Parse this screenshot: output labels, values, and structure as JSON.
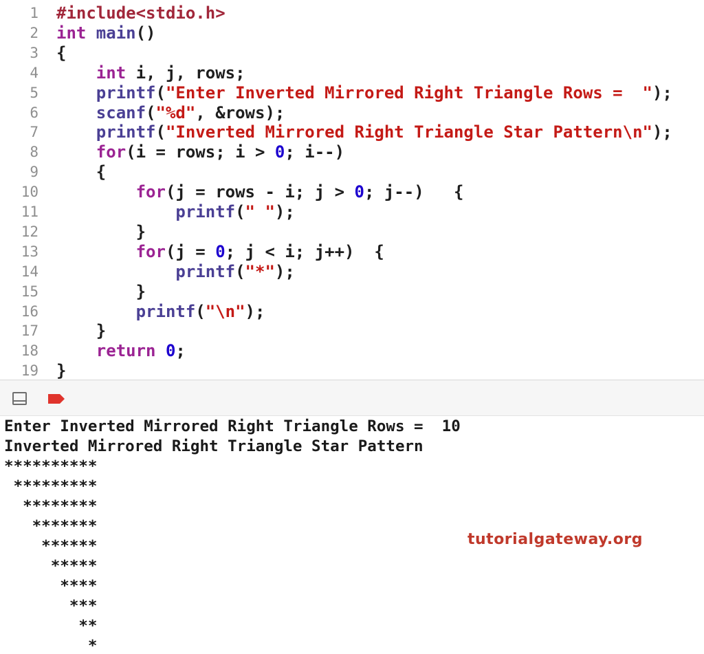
{
  "editor": {
    "lines": [
      {
        "num": "1",
        "tokens": [
          {
            "t": "#include<stdio.h>",
            "c": "pp"
          }
        ]
      },
      {
        "num": "2",
        "tokens": [
          {
            "t": "int",
            "c": "kw"
          },
          {
            "t": " main",
            "c": "fn"
          },
          {
            "t": "()",
            "c": ""
          }
        ]
      },
      {
        "num": "3",
        "tokens": [
          {
            "t": "{",
            "c": ""
          }
        ]
      },
      {
        "num": "4",
        "tokens": [
          {
            "t": "    ",
            "c": ""
          },
          {
            "t": "int",
            "c": "kw"
          },
          {
            "t": " i, j, rows;",
            "c": ""
          }
        ]
      },
      {
        "num": "5",
        "tokens": [
          {
            "t": "    ",
            "c": ""
          },
          {
            "t": "printf",
            "c": "fn"
          },
          {
            "t": "(",
            "c": ""
          },
          {
            "t": "\"Enter Inverted Mirrored Right Triangle Rows =  \"",
            "c": "str"
          },
          {
            "t": ");",
            "c": ""
          }
        ]
      },
      {
        "num": "6",
        "tokens": [
          {
            "t": "    ",
            "c": ""
          },
          {
            "t": "scanf",
            "c": "fn"
          },
          {
            "t": "(",
            "c": ""
          },
          {
            "t": "\"%d\"",
            "c": "str"
          },
          {
            "t": ", &rows);",
            "c": ""
          }
        ]
      },
      {
        "num": "7",
        "tokens": [
          {
            "t": "    ",
            "c": ""
          },
          {
            "t": "printf",
            "c": "fn"
          },
          {
            "t": "(",
            "c": ""
          },
          {
            "t": "\"Inverted Mirrored Right Triangle Star Pattern\\n\"",
            "c": "str"
          },
          {
            "t": ");",
            "c": ""
          }
        ]
      },
      {
        "num": "8",
        "tokens": [
          {
            "t": "    ",
            "c": ""
          },
          {
            "t": "for",
            "c": "kw"
          },
          {
            "t": "(i = rows; i > ",
            "c": ""
          },
          {
            "t": "0",
            "c": "num"
          },
          {
            "t": "; i--)",
            "c": ""
          }
        ]
      },
      {
        "num": "9",
        "tokens": [
          {
            "t": "    {",
            "c": ""
          }
        ]
      },
      {
        "num": "10",
        "tokens": [
          {
            "t": "        ",
            "c": ""
          },
          {
            "t": "for",
            "c": "kw"
          },
          {
            "t": "(j = rows - i; j > ",
            "c": ""
          },
          {
            "t": "0",
            "c": "num"
          },
          {
            "t": "; j--)   {",
            "c": ""
          }
        ]
      },
      {
        "num": "11",
        "tokens": [
          {
            "t": "            ",
            "c": ""
          },
          {
            "t": "printf",
            "c": "fn"
          },
          {
            "t": "(",
            "c": ""
          },
          {
            "t": "\" \"",
            "c": "str"
          },
          {
            "t": ");",
            "c": ""
          }
        ]
      },
      {
        "num": "12",
        "tokens": [
          {
            "t": "        }",
            "c": ""
          }
        ]
      },
      {
        "num": "13",
        "tokens": [
          {
            "t": "        ",
            "c": ""
          },
          {
            "t": "for",
            "c": "kw"
          },
          {
            "t": "(j = ",
            "c": ""
          },
          {
            "t": "0",
            "c": "num"
          },
          {
            "t": "; j < i; j++)  {",
            "c": ""
          }
        ]
      },
      {
        "num": "14",
        "tokens": [
          {
            "t": "            ",
            "c": ""
          },
          {
            "t": "printf",
            "c": "fn"
          },
          {
            "t": "(",
            "c": ""
          },
          {
            "t": "\"*\"",
            "c": "str"
          },
          {
            "t": ");",
            "c": ""
          }
        ]
      },
      {
        "num": "15",
        "tokens": [
          {
            "t": "        }",
            "c": ""
          }
        ]
      },
      {
        "num": "16",
        "tokens": [
          {
            "t": "        ",
            "c": ""
          },
          {
            "t": "printf",
            "c": "fn"
          },
          {
            "t": "(",
            "c": ""
          },
          {
            "t": "\"\\n\"",
            "c": "str"
          },
          {
            "t": ");",
            "c": ""
          }
        ]
      },
      {
        "num": "17",
        "tokens": [
          {
            "t": "    }",
            "c": ""
          }
        ]
      },
      {
        "num": "18",
        "tokens": [
          {
            "t": "    ",
            "c": ""
          },
          {
            "t": "return",
            "c": "kw"
          },
          {
            "t": " ",
            "c": ""
          },
          {
            "t": "0",
            "c": "num"
          },
          {
            "t": ";",
            "c": ""
          }
        ]
      },
      {
        "num": "19",
        "tokens": [
          {
            "t": "}",
            "c": ""
          }
        ]
      }
    ]
  },
  "debug_bar": {
    "panel_toggle_icon": "panel-toggle-icon",
    "breakpoint_icon": "breakpoint-icon",
    "breakpoint_color": "#e0342c"
  },
  "console": {
    "lines": [
      "Enter Inverted Mirrored Right Triangle Rows =  10",
      "Inverted Mirrored Right Triangle Star Pattern",
      "**********",
      " *********",
      "  ********",
      "   *******",
      "    ******",
      "     *****",
      "      ****",
      "       ***",
      "        **",
      "         *"
    ]
  },
  "watermark": "tutorialgateway.org"
}
